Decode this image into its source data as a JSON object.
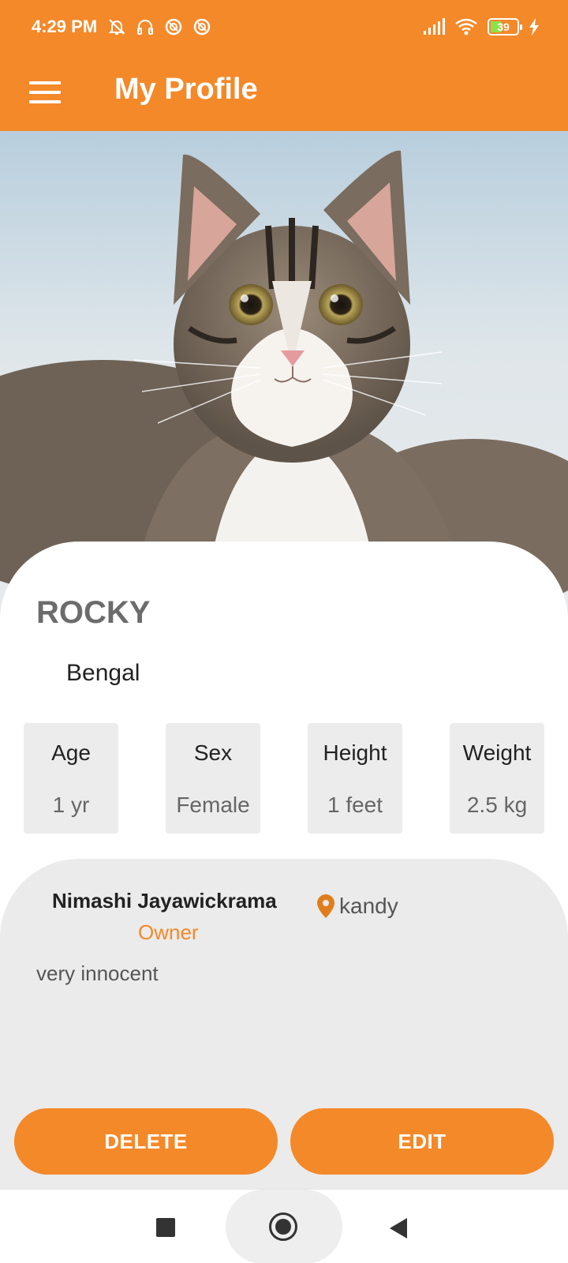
{
  "status_bar": {
    "time": "4:29 PM",
    "battery": "39",
    "icons_left": [
      "muted-bell-icon",
      "headset-icon",
      "no-disturb-icon",
      "no-disturb-icon"
    ],
    "icons_right": [
      "signal-icon",
      "wifi-icon",
      "battery-icon",
      "charging-icon"
    ]
  },
  "app_bar": {
    "title": "My Profile",
    "menu_icon": "hamburger-menu-icon"
  },
  "pet": {
    "name": "ROCKY",
    "breed": "Bengal",
    "stats": [
      {
        "label": "Age",
        "value": "1 yr"
      },
      {
        "label": "Sex",
        "value": "Female"
      },
      {
        "label": "Height",
        "value": "1 feet"
      },
      {
        "label": "Weight",
        "value": "2.5 kg"
      }
    ]
  },
  "owner": {
    "name": "Nimashi Jayawickrama",
    "role": "Owner",
    "location": "kandy",
    "description": "very innocent"
  },
  "actions": {
    "delete_label": "DELETE",
    "edit_label": "EDIT"
  },
  "colors": {
    "accent": "#f4892a",
    "card_bg": "#ebebeb"
  }
}
